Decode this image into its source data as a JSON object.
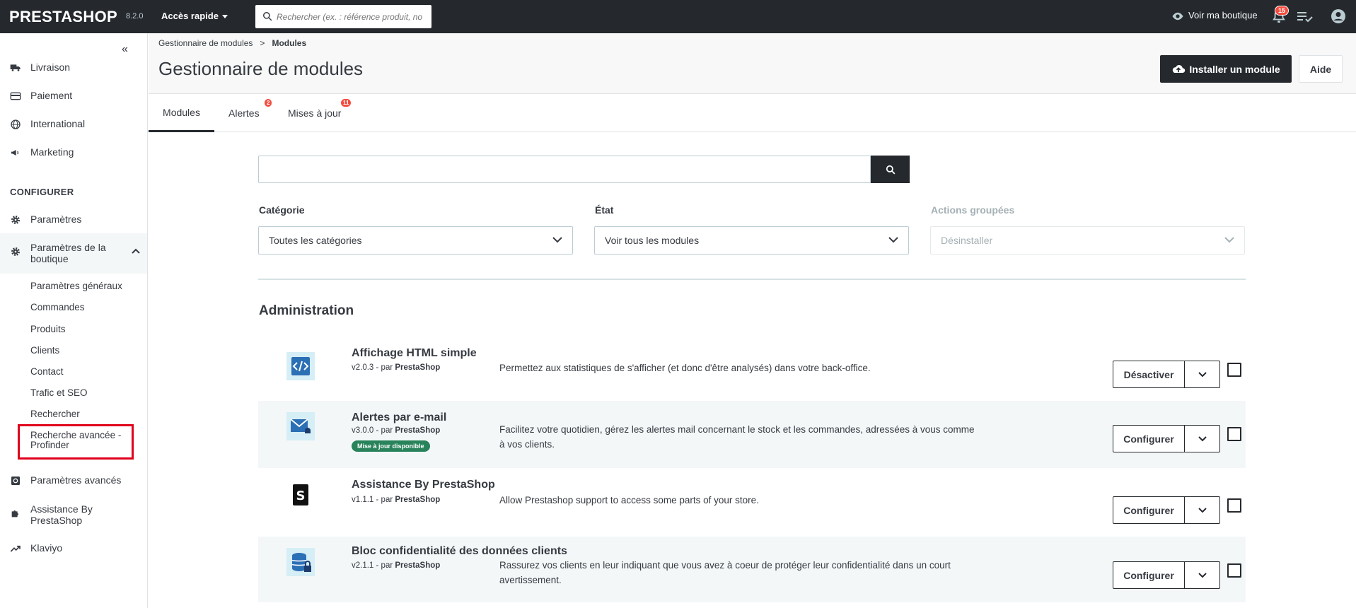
{
  "topbar": {
    "logo": "PRESTASHOP",
    "version": "8.2.0",
    "quick_access": "Accès rapide",
    "search_placeholder": "Rechercher (ex. : référence produit, no",
    "view_shop": "Voir ma boutique",
    "notifications_count": "15"
  },
  "sidebar": {
    "items_top": [
      {
        "label": "Livraison",
        "icon": "truck-icon"
      },
      {
        "label": "Paiement",
        "icon": "credit-card-icon"
      },
      {
        "label": "International",
        "icon": "globe-icon"
      },
      {
        "label": "Marketing",
        "icon": "megaphone-icon"
      }
    ],
    "section_configure": "CONFIGURER",
    "parametres": "Paramètres",
    "shop_params": "Paramètres de la boutique",
    "sub_items": [
      "Paramètres généraux",
      "Commandes",
      "Produits",
      "Clients",
      "Contact",
      "Trafic et SEO",
      "Rechercher",
      "Recherche avancée - Profinder"
    ],
    "advanced_params": "Paramètres avancés",
    "assistance": "Assistance By PrestaShop",
    "klaviyo": "Klaviyo"
  },
  "header": {
    "breadcrumb_parent": "Gestionnaire de modules",
    "breadcrumb_current": "Modules",
    "title": "Gestionnaire de modules",
    "install_button": "Installer un module",
    "help_button": "Aide"
  },
  "tabs": [
    {
      "label": "Modules",
      "badge": ""
    },
    {
      "label": "Alertes",
      "badge": "2"
    },
    {
      "label": "Mises à jour",
      "badge": "11"
    }
  ],
  "filters": {
    "category_label": "Catégorie",
    "category_value": "Toutes les catégories",
    "state_label": "État",
    "state_value": "Voir tous les modules",
    "bulk_label": "Actions groupées",
    "bulk_value": "Désinstaller"
  },
  "category_title": "Administration",
  "modules": [
    {
      "name": "Affichage HTML simple",
      "version": "v2.0.3 - par",
      "author": "PrestaShop",
      "badge": "",
      "description": "Permettez aux statistiques de s'afficher (et donc d'être analysés) dans votre back-office.",
      "action": "Désactiver",
      "icon": "html-code-icon"
    },
    {
      "name": "Alertes par e-mail",
      "version": "v3.0.0 - par",
      "author": "PrestaShop",
      "badge": "Mise à jour disponible",
      "description": "Facilitez votre quotidien, gérez les alertes mail concernant le stock et les commandes, adressées à vous comme à vos clients.",
      "action": "Configurer",
      "icon": "mail-alert-icon"
    },
    {
      "name": "Assistance By PrestaShop",
      "version": "v1.1.1 - par",
      "author": "PrestaShop",
      "badge": "",
      "description": "Allow Prestashop support to access some parts of your store.",
      "action": "Configurer",
      "icon": "prestashop-p-icon"
    },
    {
      "name": "Bloc confidentialité des données clients",
      "version": "v2.1.1 - par",
      "author": "PrestaShop",
      "badge": "",
      "description": "Rassurez vos clients en leur indiquant que vous avez à coeur de protéger leur confidentialité dans un court avertissement.",
      "action": "Configurer",
      "icon": "database-lock-icon"
    }
  ],
  "colors": {
    "topbar": "#25292e",
    "badge_red": "#f54c3e",
    "update_green": "#28835a",
    "highlight_red": "#e0001b"
  }
}
